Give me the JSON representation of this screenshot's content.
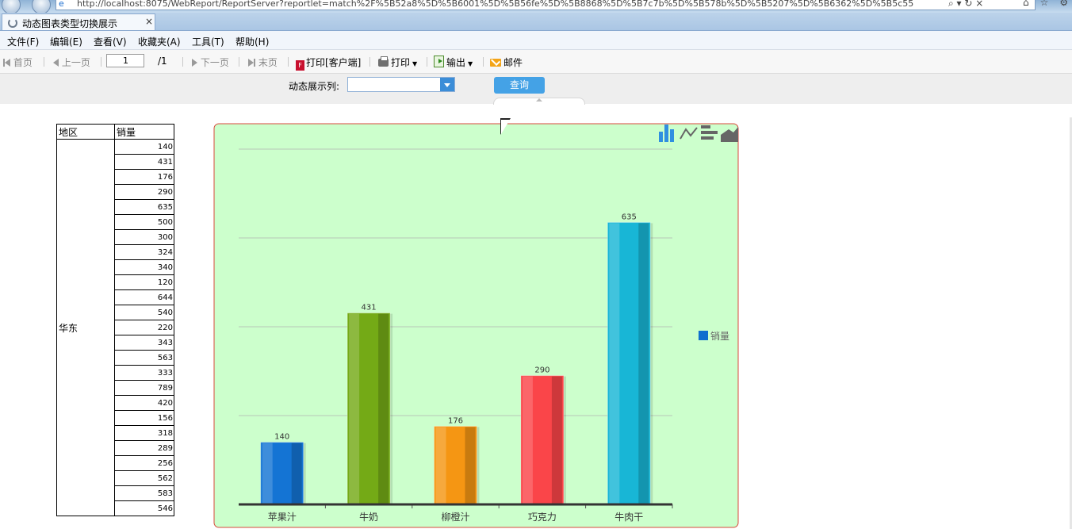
{
  "browser": {
    "url": "http://localhost:8075/WebReport/ReportServer?reportlet=match%2F%5B52a8%5D%5B6001%5D%5B56fe%5D%5B8868%5D%5B7c7b%5D%5B578b%5D%5B5207%5D%5B6362%5D%5B5c55",
    "tab_title": "动态图表类型切换展示",
    "tab_close": "×"
  },
  "menu": {
    "file": "文件(F)",
    "edit": "编辑(E)",
    "view": "查看(V)",
    "favorites": "收藏夹(A)",
    "tools": "工具(T)",
    "help": "帮助(H)"
  },
  "toolbar": {
    "first": "首页",
    "prev": "上一页",
    "page_value": "1",
    "page_total": "/1",
    "next": "下一页",
    "last": "末页",
    "print_client": "打印[客户端]",
    "print": "打印",
    "export": "输出",
    "email": "邮件"
  },
  "params": {
    "label": "动态展示列:",
    "select_value": "",
    "query_label": "查询"
  },
  "table": {
    "headers": [
      "地区",
      "销量"
    ],
    "region": "华东",
    "values": [
      "140",
      "431",
      "176",
      "290",
      "635",
      "500",
      "300",
      "324",
      "340",
      "120",
      "644",
      "540",
      "220",
      "343",
      "563",
      "333",
      "789",
      "420",
      "156",
      "318",
      "289",
      "256",
      "562",
      "583",
      "546"
    ]
  },
  "chart_data": {
    "type": "bar",
    "categories": [
      "苹果汁",
      "牛奶",
      "柳橙汁",
      "巧克力",
      "牛肉干"
    ],
    "series": [
      {
        "name": "销量",
        "values": [
          140,
          431,
          176,
          290,
          635
        ]
      }
    ],
    "bar_colors": [
      "#1474d4",
      "#74aa16",
      "#f59613",
      "#fa4549",
      "#18b6d6"
    ],
    "legend_color": "#0f6fce",
    "ylim": [
      0,
      800
    ],
    "grid": true,
    "legend_position": "right",
    "background": "#ccffcc",
    "border_color": "#d94a3c"
  },
  "chart_type_icons": [
    "bar-chart-icon",
    "line-chart-icon",
    "horizontal-bar-chart-icon",
    "area-chart-icon"
  ]
}
